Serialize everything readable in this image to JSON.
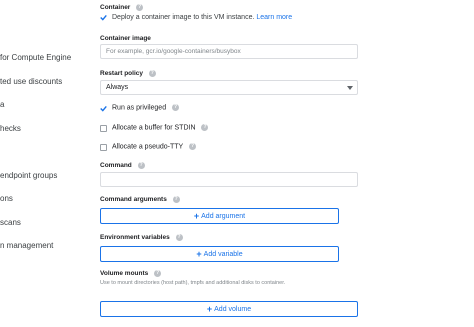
{
  "sidebar": {
    "items": [
      {
        "label": "for Compute Engine"
      },
      {
        "label": "ted use discounts"
      },
      {
        "label": "a"
      },
      {
        "label": "hecks"
      },
      {
        "label": "endpoint groups"
      },
      {
        "label": "ons"
      },
      {
        "label": "scans"
      },
      {
        "label": "n management"
      }
    ]
  },
  "container": {
    "label": "Container",
    "deploy_text": "Deploy a container image to this VM instance.",
    "learn_more": "Learn more",
    "deploy_checked": true
  },
  "container_image": {
    "label": "Container image",
    "placeholder": "For example, gcr.io/google-containers/busybox",
    "value": ""
  },
  "restart_policy": {
    "label": "Restart policy",
    "selected": "Always"
  },
  "options": {
    "privileged": {
      "label": "Run as privileged",
      "checked": true
    },
    "stdin": {
      "label": "Allocate a buffer for STDIN",
      "checked": false
    },
    "tty": {
      "label": "Allocate a pseudo-TTY",
      "checked": false
    }
  },
  "command": {
    "label": "Command",
    "value": ""
  },
  "command_arguments": {
    "label": "Command arguments",
    "button": "Add argument"
  },
  "environment_variables": {
    "label": "Environment variables",
    "button": "Add variable"
  },
  "volume_mounts": {
    "label": "Volume mounts",
    "description": "Use to mount directories (host path), tmpfs and additional disks to container.",
    "button": "Add volume"
  },
  "icons": {
    "help": "help-icon",
    "add": "plus-icon",
    "dropdown": "chevron-down-icon",
    "check": "check-icon"
  },
  "colors": {
    "accent": "#1a73e8",
    "border": "#dadce0",
    "text": "#202124",
    "muted": "#80868b"
  }
}
